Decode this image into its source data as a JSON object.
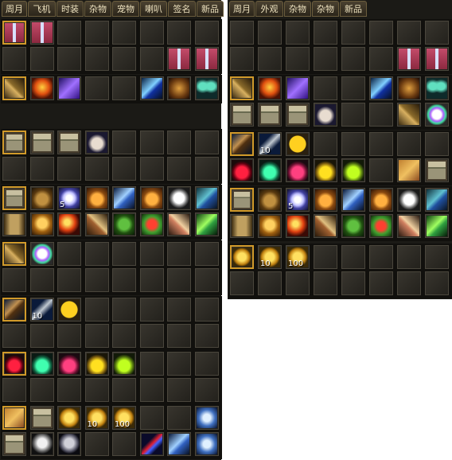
{
  "left_panel": {
    "tabs": [
      "周月",
      "飞机",
      "时装",
      "杂物",
      "宠物",
      "喇叭",
      "签名",
      "新品"
    ],
    "sections": [
      {
        "rows": [
          [
            {
              "icon": "gift-box-icon",
              "selected": true
            },
            {
              "icon": "gift-box-icon"
            },
            null,
            null,
            null,
            null,
            null,
            null
          ],
          [
            null,
            null,
            null,
            null,
            null,
            null,
            {
              "icon": "gift-box-icon"
            },
            {
              "icon": "gift-box-icon"
            }
          ]
        ]
      },
      {
        "rows": [
          [
            {
              "icon": "golden-weapon-icon",
              "selected": true
            },
            {
              "icon": "phoenix-icon"
            },
            {
              "icon": "purple-effect-icon"
            },
            null,
            null,
            {
              "icon": "lightning-icon"
            },
            {
              "icon": "bronze-dragon-icon"
            },
            {
              "icon": "butterfly-wings-icon"
            }
          ]
        ]
      },
      {
        "rows": [
          [
            {
              "icon": "treasure-chest-icon",
              "selected": true
            },
            {
              "icon": "treasure-chest-icon"
            },
            {
              "icon": "treasure-chest-icon"
            },
            {
              "icon": "goat-pet-icon"
            },
            null,
            null,
            null,
            null
          ],
          [
            null,
            null,
            null,
            null,
            null,
            null,
            null,
            null
          ]
        ]
      },
      {
        "rows": [
          [
            {
              "icon": "treasure-chest-icon",
              "selected": true
            },
            {
              "icon": "money-bag-icon"
            },
            {
              "icon": "glowing-orb-icon",
              "count": "5"
            },
            {
              "icon": "bell-icon"
            },
            {
              "icon": "ice-crystal-icon"
            },
            {
              "icon": "bell-icon"
            },
            {
              "icon": "white-moon-icon"
            },
            {
              "icon": "rune-scroll-icon"
            }
          ],
          [
            {
              "icon": "golden-door-icon"
            },
            {
              "icon": "golden-statue-icon"
            },
            {
              "icon": "fire-ball-icon"
            },
            {
              "icon": "wooden-staff-icon"
            },
            {
              "icon": "green-beast-icon"
            },
            {
              "icon": "fruit-icon"
            },
            {
              "icon": "magic-wand-icon"
            },
            {
              "icon": "green-rune-icon"
            }
          ]
        ]
      },
      {
        "rows": [
          [
            {
              "icon": "golden-weapon-icon",
              "selected": true
            },
            {
              "icon": "rainbow-egg-icon"
            },
            null,
            null,
            null,
            null,
            null,
            null
          ],
          [
            null,
            null,
            null,
            null,
            null,
            null,
            null,
            null
          ]
        ]
      },
      {
        "rows": [
          [
            {
              "icon": "bow-icon",
              "selected": true
            },
            {
              "icon": "arrows-icon",
              "count": "10"
            },
            {
              "icon": "smiley-face-icon"
            },
            null,
            null,
            null,
            null,
            null
          ],
          [
            null,
            null,
            null,
            null,
            null,
            null,
            null,
            null
          ]
        ]
      },
      {
        "rows": [
          [
            {
              "icon": "red-potion-icon",
              "selected": true
            },
            {
              "icon": "green-potion-icon"
            },
            {
              "icon": "pink-potion-icon"
            },
            {
              "icon": "yellow-potion-icon"
            },
            {
              "icon": "lime-potion-icon"
            },
            null,
            null,
            null
          ],
          [
            null,
            null,
            null,
            null,
            null,
            null,
            null,
            null
          ]
        ]
      },
      {
        "rows": [
          [
            {
              "icon": "map-scroll-icon",
              "selected": true
            },
            {
              "icon": "treasure-chest-icon"
            },
            {
              "icon": "gold-coin-icon"
            },
            {
              "icon": "gold-coin-icon",
              "count": "10"
            },
            {
              "icon": "gold-coin-icon",
              "count": "100"
            },
            null,
            null,
            {
              "icon": "ice-dragon-icon"
            }
          ],
          [
            {
              "icon": "treasure-chest-icon"
            },
            {
              "icon": "silver-bust-icon"
            },
            {
              "icon": "silver-wolf-icon"
            },
            null,
            null,
            {
              "icon": "crimson-dagger-icon"
            },
            {
              "icon": "ice-crystal-icon"
            },
            {
              "icon": "ice-dragon-icon"
            }
          ]
        ]
      }
    ]
  },
  "right_panel": {
    "tabs": [
      "周月",
      "外观",
      "杂物",
      "杂物",
      "新品"
    ],
    "sections": [
      {
        "rows": [
          [
            null,
            null,
            null,
            null,
            null,
            null,
            null,
            null
          ],
          [
            null,
            null,
            null,
            null,
            null,
            null,
            {
              "icon": "gift-box-icon"
            },
            {
              "icon": "gift-box-icon"
            }
          ]
        ]
      },
      {
        "rows": [
          [
            {
              "icon": "golden-weapon-icon",
              "selected": true
            },
            {
              "icon": "phoenix-icon"
            },
            {
              "icon": "purple-effect-icon"
            },
            null,
            null,
            {
              "icon": "lightning-icon"
            },
            {
              "icon": "bronze-dragon-icon"
            },
            {
              "icon": "butterfly-wings-icon"
            }
          ],
          [
            {
              "icon": "treasure-chest-icon"
            },
            {
              "icon": "treasure-chest-icon"
            },
            {
              "icon": "treasure-chest-icon"
            },
            {
              "icon": "goat-pet-icon"
            },
            null,
            null,
            {
              "icon": "golden-weapon-icon"
            },
            {
              "icon": "rainbow-egg-icon"
            }
          ]
        ]
      },
      {
        "rows": [
          [
            {
              "icon": "bow-icon",
              "selected": true
            },
            {
              "icon": "arrows-icon",
              "count": "10"
            },
            {
              "icon": "smiley-face-icon"
            },
            null,
            null,
            null,
            null,
            null
          ],
          [
            {
              "icon": "red-potion-icon"
            },
            {
              "icon": "green-potion-icon"
            },
            {
              "icon": "pink-potion-icon"
            },
            {
              "icon": "yellow-potion-icon"
            },
            {
              "icon": "lime-potion-icon"
            },
            null,
            {
              "icon": "map-scroll-icon"
            },
            {
              "icon": "treasure-chest-icon"
            }
          ]
        ]
      },
      {
        "rows": [
          [
            {
              "icon": "treasure-chest-icon",
              "selected": true
            },
            {
              "icon": "money-bag-icon"
            },
            {
              "icon": "glowing-orb-icon",
              "count": "5"
            },
            {
              "icon": "bell-icon"
            },
            {
              "icon": "ice-crystal-icon"
            },
            {
              "icon": "bell-icon"
            },
            {
              "icon": "white-moon-icon"
            },
            {
              "icon": "rune-scroll-icon"
            }
          ],
          [
            {
              "icon": "golden-door-icon"
            },
            {
              "icon": "golden-statue-icon"
            },
            {
              "icon": "fire-ball-icon"
            },
            {
              "icon": "wooden-staff-icon"
            },
            {
              "icon": "green-beast-icon"
            },
            {
              "icon": "fruit-icon"
            },
            {
              "icon": "magic-wand-icon"
            },
            {
              "icon": "green-rune-icon"
            }
          ]
        ]
      },
      {
        "rows": [
          [
            {
              "icon": "gold-coin-icon",
              "selected": true
            },
            {
              "icon": "gold-coin-icon",
              "count": "10"
            },
            {
              "icon": "gold-coin-icon",
              "count": "100"
            },
            null,
            null,
            null,
            null,
            null
          ],
          [
            null,
            null,
            null,
            null,
            null,
            null,
            null,
            null
          ]
        ]
      }
    ]
  },
  "colors": {
    "panel_bg": "#1b1a16",
    "slot_border": "#4a463c",
    "selected_border": "#d19a2a",
    "tab_text": "#ece0bd"
  }
}
